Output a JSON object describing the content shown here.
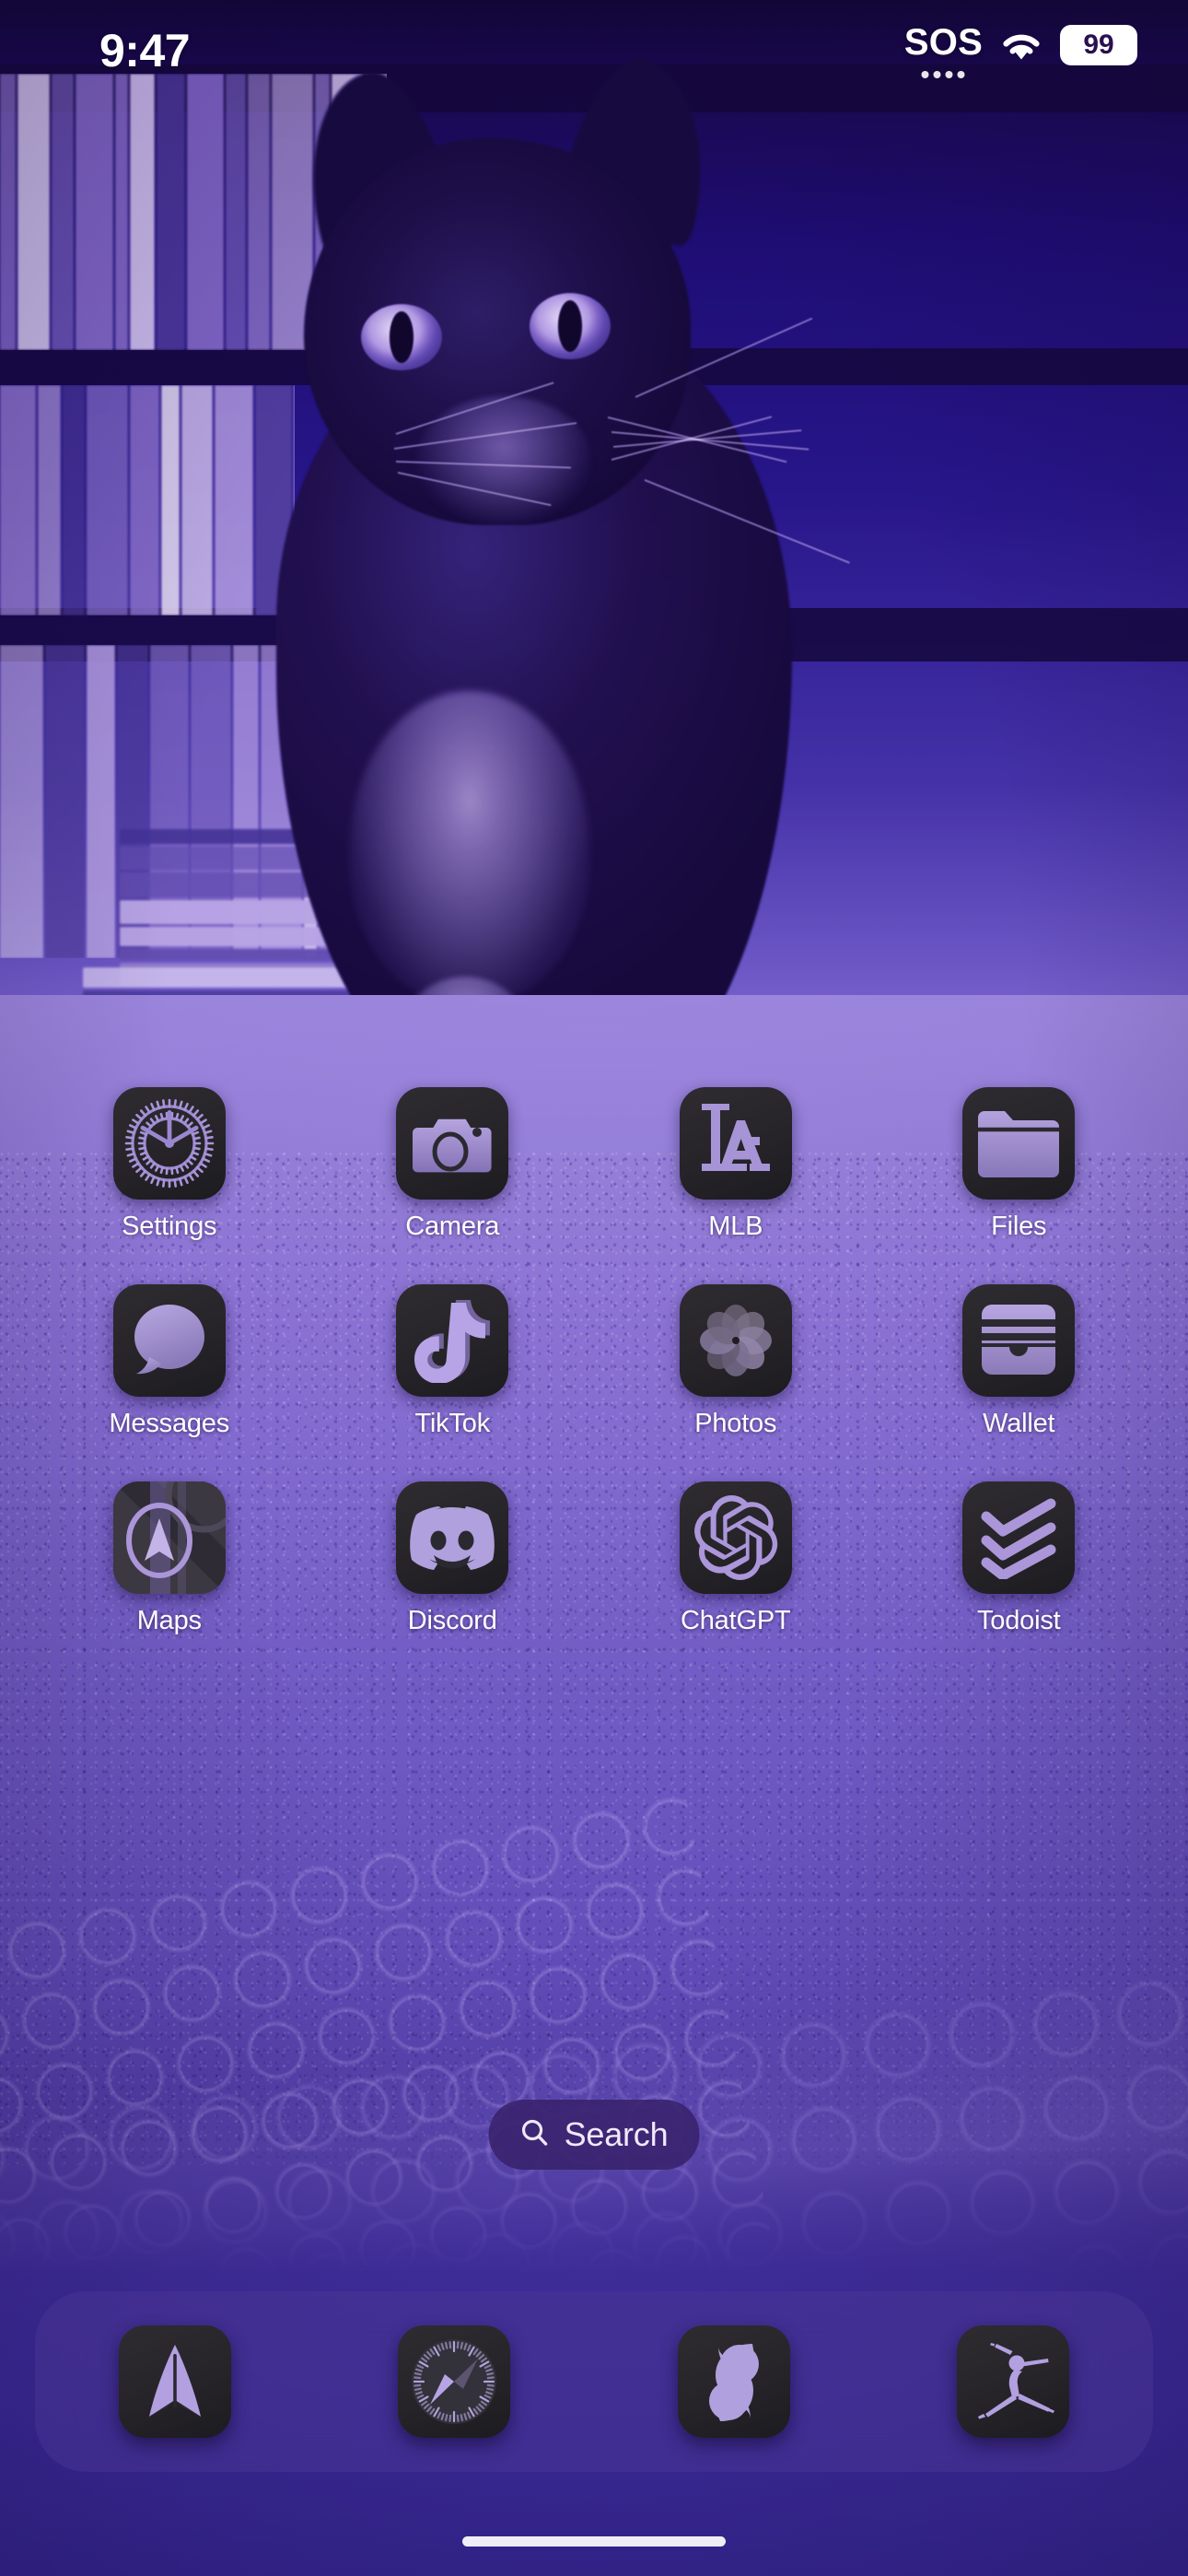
{
  "status_bar": {
    "time": "9:47",
    "sos_label": "SOS",
    "wifi_icon": "wifi-icon",
    "battery_level": "99"
  },
  "wallpaper": {
    "description": "purple duotone photo of a cat on a towel in front of a bookshelf",
    "tint_color": "#6a4fc0"
  },
  "home_screen": {
    "apps": [
      {
        "label": "Settings",
        "icon": "settings-gear-icon"
      },
      {
        "label": "Camera",
        "icon": "camera-icon"
      },
      {
        "label": "MLB",
        "icon": "mlb-la-dodgers-icon"
      },
      {
        "label": "Files",
        "icon": "files-folder-icon"
      },
      {
        "label": "Messages",
        "icon": "messages-bubble-icon"
      },
      {
        "label": "TikTok",
        "icon": "tiktok-note-icon"
      },
      {
        "label": "Photos",
        "icon": "photos-pinwheel-icon"
      },
      {
        "label": "Wallet",
        "icon": "wallet-cards-icon"
      },
      {
        "label": "Maps",
        "icon": "maps-arrow-icon"
      },
      {
        "label": "Discord",
        "icon": "discord-clyde-icon"
      },
      {
        "label": "ChatGPT",
        "icon": "chatgpt-knot-icon"
      },
      {
        "label": "Todoist",
        "icon": "todoist-chevrons-icon"
      }
    ]
  },
  "search": {
    "label": "Search",
    "icon": "search-magnifier-icon"
  },
  "dock": {
    "apps": [
      {
        "icon": "paper-plane-icon"
      },
      {
        "icon": "safari-compass-icon"
      },
      {
        "icon": "yin-yang-s-icon"
      },
      {
        "icon": "dancer-figure-icon"
      }
    ]
  },
  "icon_theme": {
    "style": "dark-tinted",
    "glyph_color": "#ab96da",
    "base_color": "#282629"
  }
}
